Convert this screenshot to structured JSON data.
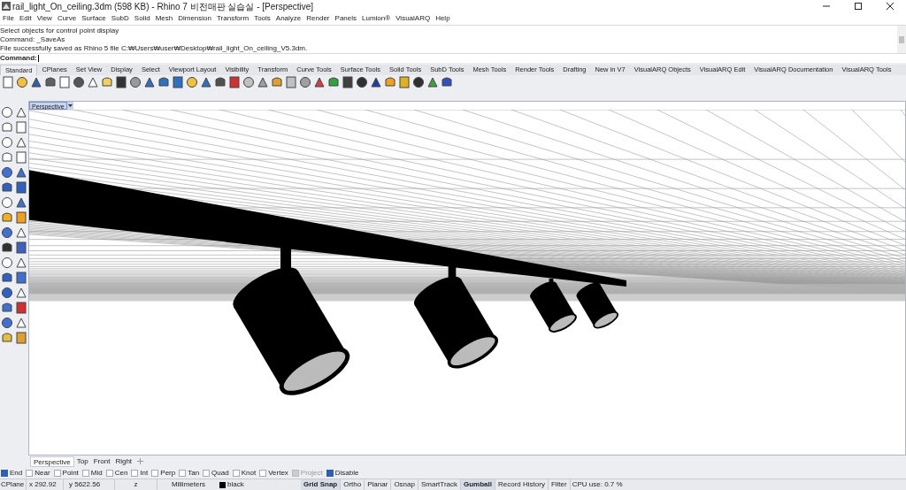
{
  "window": {
    "title": "rail_light_On_ceiling.3dm (598 KB) - Rhino 7 비전매판 실습실 - [Perspective]"
  },
  "menu": [
    "File",
    "Edit",
    "View",
    "Curve",
    "Surface",
    "SubD",
    "Solid",
    "Mesh",
    "Dimension",
    "Transform",
    "Tools",
    "Analyze",
    "Render",
    "Panels",
    "Lumion®",
    "VisualARQ",
    "Help"
  ],
  "command_history": [
    "Select objects for control point display",
    "Command: _SaveAs",
    "File successfully saved as Rhino 5 file C:₩Users₩user₩Desktop₩rail_light_On_ceiling_V5.3dm."
  ],
  "command_prompt": {
    "label": "Command:"
  },
  "toolbar_tabs": [
    {
      "label": "Standard",
      "selected": true
    },
    {
      "label": "CPlanes",
      "selected": false
    },
    {
      "label": "Set View",
      "selected": false
    },
    {
      "label": "Display",
      "selected": false
    },
    {
      "label": "Select",
      "selected": false
    },
    {
      "label": "Viewport Layout",
      "selected": false
    },
    {
      "label": "Visibility",
      "selected": false
    },
    {
      "label": "Transform",
      "selected": false
    },
    {
      "label": "Curve Tools",
      "selected": false
    },
    {
      "label": "Surface Tools",
      "selected": false
    },
    {
      "label": "Solid Tools",
      "selected": false
    },
    {
      "label": "SubD Tools",
      "selected": false
    },
    {
      "label": "Mesh Tools",
      "selected": false
    },
    {
      "label": "Render Tools",
      "selected": false
    },
    {
      "label": "Drafting",
      "selected": false
    },
    {
      "label": "New in V7",
      "selected": false
    },
    {
      "label": "VisualARQ Objects",
      "selected": false
    },
    {
      "label": "VisualARQ Edit",
      "selected": false
    },
    {
      "label": "VisualARQ Documentation",
      "selected": false
    },
    {
      "label": "VisualARQ Tools",
      "selected": false
    }
  ],
  "viewport": {
    "title": "Perspective"
  },
  "viewport_tabs": [
    {
      "label": "Perspective",
      "selected": true
    },
    {
      "label": "Top",
      "selected": false
    },
    {
      "label": "Front",
      "selected": false
    },
    {
      "label": "Right",
      "selected": false
    }
  ],
  "osnaps": [
    {
      "label": "End",
      "checked": true,
      "disabled": false
    },
    {
      "label": "Near",
      "checked": false,
      "disabled": false
    },
    {
      "label": "Point",
      "checked": false,
      "disabled": false
    },
    {
      "label": "Mid",
      "checked": false,
      "disabled": false
    },
    {
      "label": "Cen",
      "checked": false,
      "disabled": false
    },
    {
      "label": "Int",
      "checked": false,
      "disabled": false
    },
    {
      "label": "Perp",
      "checked": false,
      "disabled": false
    },
    {
      "label": "Tan",
      "checked": false,
      "disabled": false
    },
    {
      "label": "Quad",
      "checked": false,
      "disabled": false
    },
    {
      "label": "Knot",
      "checked": false,
      "disabled": false
    },
    {
      "label": "Vertex",
      "checked": false,
      "disabled": false
    },
    {
      "label": "Project",
      "checked": false,
      "disabled": true
    },
    {
      "label": "Disable",
      "checked": true,
      "disabled": false
    }
  ],
  "status_bar": {
    "cplane": "CPlane",
    "x": "x 292.92",
    "y": "y 5622.56",
    "z": "z",
    "units": "Millimeters",
    "layer": {
      "name": "black",
      "color": "#000000"
    },
    "toggles": [
      {
        "label": "Grid Snap",
        "on": true
      },
      {
        "label": "Ortho",
        "on": false
      },
      {
        "label": "Planar",
        "on": false
      },
      {
        "label": "Osnap",
        "on": false
      },
      {
        "label": "SmartTrack",
        "on": false
      },
      {
        "label": "Gumball",
        "on": true
      },
      {
        "label": "Record History",
        "on": false
      },
      {
        "label": "Filter",
        "on": false
      }
    ],
    "cpu": "CPU use: 0.7 %"
  }
}
